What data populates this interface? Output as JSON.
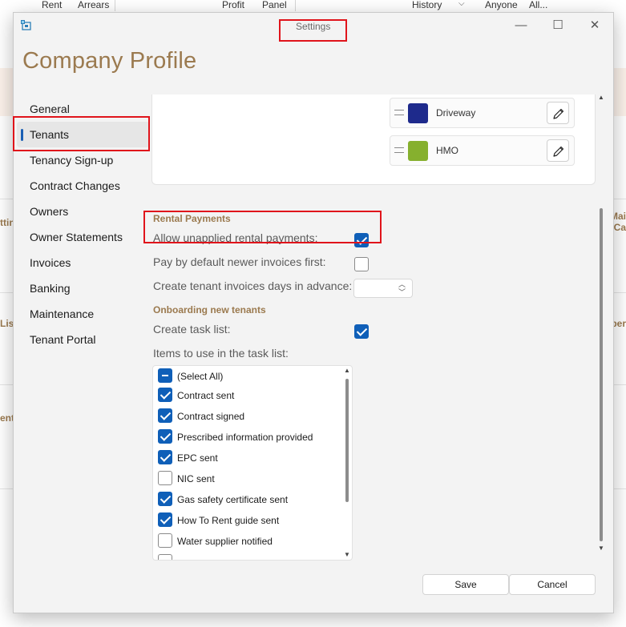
{
  "background_app": {
    "header_labels": [
      "Rent",
      "Arrears",
      "Profit",
      "Panel",
      "History",
      "Anyone",
      "All..."
    ],
    "fragments_left": [
      "ttin",
      "Lis",
      "ent"
    ],
    "fragments_right": [
      "Mai",
      "Ca",
      "per"
    ]
  },
  "window": {
    "title": "Settings",
    "minimize": "—",
    "maximize": "☐",
    "close": "✕"
  },
  "page_title": "Company Profile",
  "nav": {
    "items": [
      {
        "label": "General"
      },
      {
        "label": "Tenants",
        "selected": true
      },
      {
        "label": "Tenancy Sign-up"
      },
      {
        "label": "Contract Changes"
      },
      {
        "label": "Owners"
      },
      {
        "label": "Owner Statements"
      },
      {
        "label": "Invoices"
      },
      {
        "label": "Banking"
      },
      {
        "label": "Maintenance"
      },
      {
        "label": "Tenant Portal"
      }
    ]
  },
  "color_rows": [
    {
      "label": "Driveway",
      "color": "#1e2a8c"
    },
    {
      "label": "HMO",
      "color": "#86b02e"
    }
  ],
  "rental_payments": {
    "heading": "Rental Payments",
    "allow_unapplied_label": "Allow unapplied rental payments:",
    "allow_unapplied_checked": true,
    "pay_newer_first_label": "Pay by default newer invoices first:",
    "pay_newer_first_checked": false,
    "invoice_days_label": "Create tenant invoices days in advance:",
    "invoice_days_value": ""
  },
  "onboarding": {
    "heading": "Onboarding new tenants",
    "create_task_list_label": "Create task list:",
    "create_task_list_checked": true,
    "items_label": "Items to use in the task list:",
    "items": [
      {
        "label": "(Select All)",
        "state": "indeterminate"
      },
      {
        "label": "Contract sent",
        "state": "checked"
      },
      {
        "label": "Contract signed",
        "state": "checked"
      },
      {
        "label": "Prescribed information provided",
        "state": "checked"
      },
      {
        "label": "EPC sent",
        "state": "checked"
      },
      {
        "label": "NIC sent",
        "state": "unchecked"
      },
      {
        "label": "Gas safety certificate sent",
        "state": "checked"
      },
      {
        "label": "How To Rent guide sent",
        "state": "checked"
      },
      {
        "label": "Water supplier notified",
        "state": "unchecked"
      },
      {
        "label": "",
        "state": "unchecked"
      }
    ]
  },
  "footer": {
    "save_label": "Save",
    "cancel_label": "Cancel"
  },
  "colors": {
    "accent": "#0f5fb8",
    "heading_brown": "#9b7a4f",
    "annotation_red": "#e0141b"
  }
}
